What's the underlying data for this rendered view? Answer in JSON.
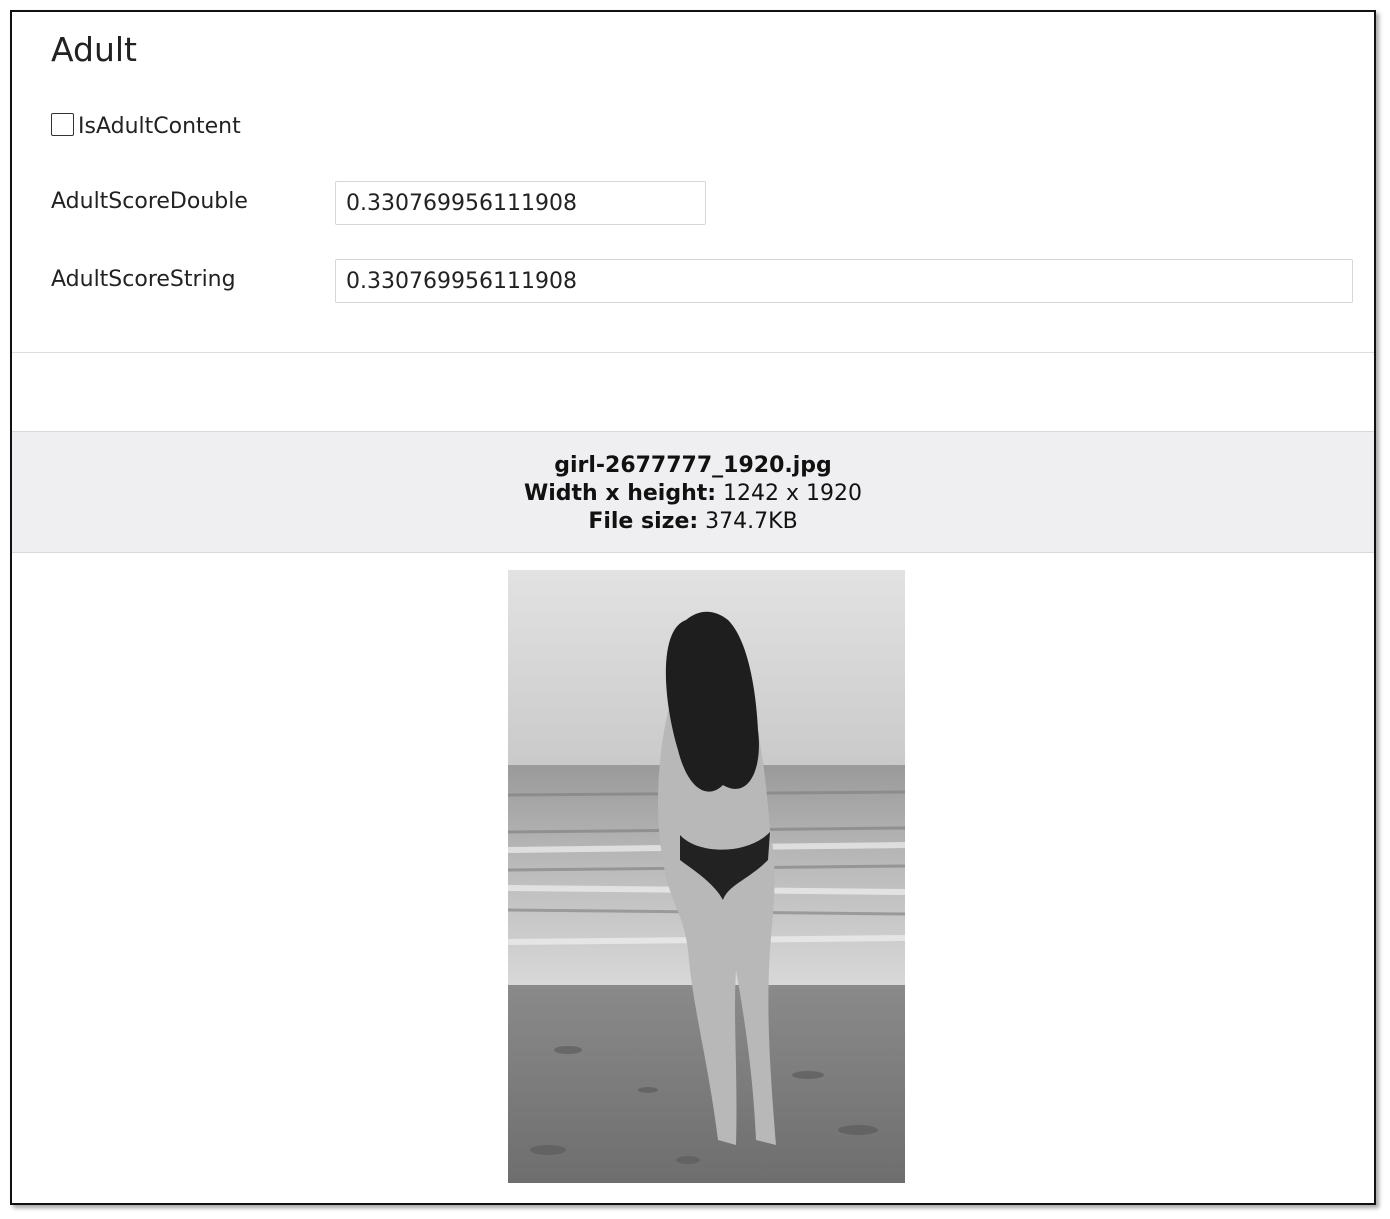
{
  "section": {
    "title": "Adult"
  },
  "fields": {
    "is_adult_content": {
      "label": "IsAdultContent",
      "checked": false
    },
    "adult_score_double": {
      "label": "AdultScoreDouble",
      "value": "0.330769956111908"
    },
    "adult_score_string": {
      "label": "AdultScoreString",
      "value": "0.330769956111908"
    }
  },
  "image_info": {
    "filename": "girl-2677777_1920.jpg",
    "dimensions_label": "Width x height:",
    "dimensions_value": "1242 x 1920",
    "filesize_label": "File size:",
    "filesize_value": "374.7KB"
  }
}
